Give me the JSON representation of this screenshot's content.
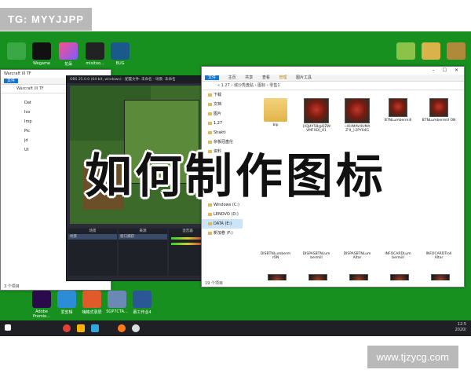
{
  "tag": {
    "text": "TG: MYYJJPP"
  },
  "watermark": {
    "text": "www.tjzycg.com"
  },
  "overlay": {
    "title": "如何制作图标"
  },
  "desktop": {
    "icons": [
      {
        "label": "Wegame"
      },
      {
        "label": "花朵"
      },
      {
        "label": "mixitoo..."
      },
      {
        "label": "BUG"
      }
    ]
  },
  "explorer": {
    "ribbon": {
      "tab_file": "文件",
      "tab_home": "主页",
      "tab_share": "共享",
      "tab_view": "查看",
      "tab_manage": "管理",
      "tab_tools": "图片工具"
    },
    "address": "« 1.27 › 城沙秀盘贴 › 图标 › 零售1",
    "nav": [
      {
        "label": "下载"
      },
      {
        "label": "文档"
      },
      {
        "label": "图片"
      },
      {
        "label": "1.27"
      },
      {
        "label": "Shakti"
      },
      {
        "label": "杂板冠盘伦"
      },
      {
        "label": "资料"
      },
      {
        "label": "Windows (C:)"
      },
      {
        "label": "LENOVO (D:)"
      },
      {
        "label": "DATA (E:)"
      },
      {
        "label": "新加卷 (F:)"
      }
    ],
    "files": [
      {
        "name": "blp"
      },
      {
        "name": "{IQJ4Y58@QZW VMFXD]_01"
      },
      {
        "name": "~KHMAV4UMA Z'9_}2PY04G"
      },
      {
        "name": "BTNLumbermill"
      },
      {
        "name": "BTNLumbermill ON"
      },
      {
        "name": "DISBTNLumberm rON"
      },
      {
        "name": "DISPASBTNLum bermill"
      },
      {
        "name": "DISPASBTNLum Altar"
      },
      {
        "name": "INFOCARDLum bermill"
      },
      {
        "name": "INFOCARDTroll Altar"
      }
    ],
    "status": "19 个项目"
  },
  "back_explorer": {
    "title": "Warcraft III TF",
    "status": "3 个项目",
    "nav": [
      {
        "label": "Dat"
      },
      {
        "label": "Ico"
      },
      {
        "label": "Imp"
      },
      {
        "label": "Pic"
      },
      {
        "label": "jd"
      },
      {
        "label": "Ut"
      }
    ]
  },
  "obs": {
    "title": "OBS 25.0.0 (64-bit, windows) - 配置文件: 未命名 - 场景: 未命名",
    "panels": {
      "scenes": "场景",
      "sources": "来源",
      "mixer": "混音器"
    },
    "scene_item": "场景",
    "source_item": "窗口捕获"
  },
  "taskbar": {
    "apps": [
      {
        "label": "Adobe Premie..."
      },
      {
        "label": "爱剪辑"
      },
      {
        "label": "嗨格式录屏"
      },
      {
        "label": "SQP7CTA..."
      },
      {
        "label": "幕工作业4"
      }
    ],
    "time": "12:5",
    "date": "2020/"
  },
  "colors": {
    "desktop": "#17901f",
    "taskbar": "#1e2024",
    "accent": "#1a73c8",
    "overlay_text": "#111111"
  }
}
